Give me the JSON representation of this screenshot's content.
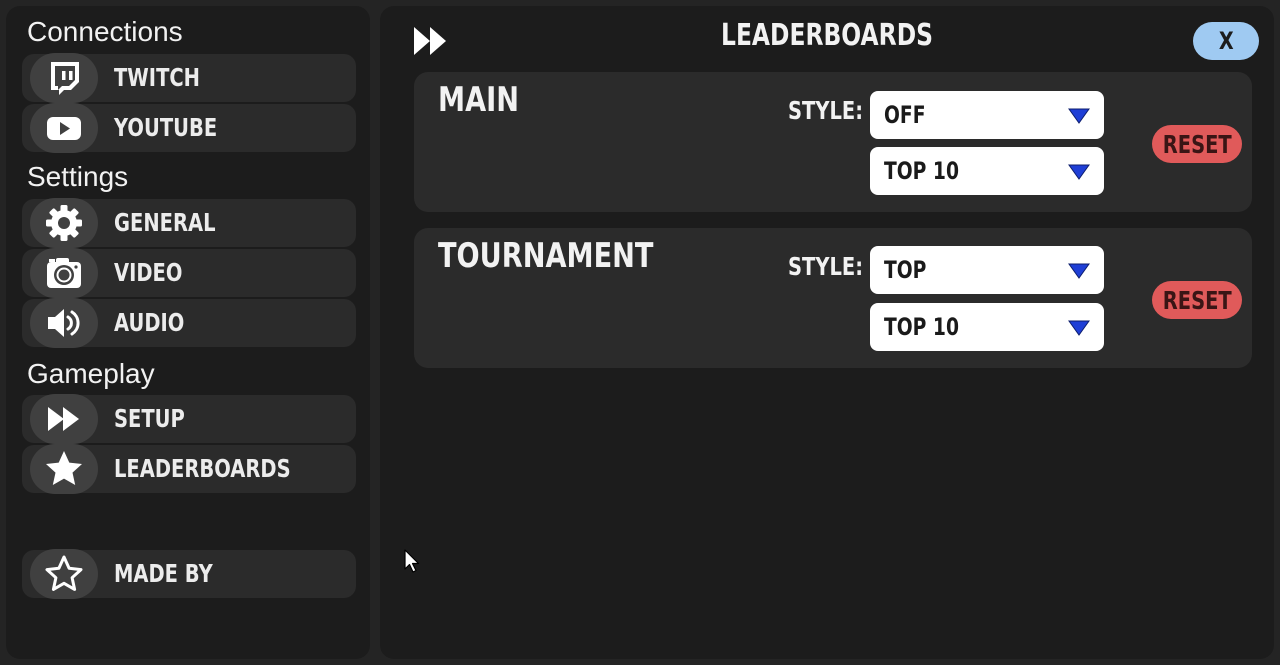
{
  "sidebar": {
    "sections": {
      "connections": "Connections",
      "settings": "Settings",
      "gameplay": "Gameplay"
    },
    "items": {
      "twitch": {
        "label": "TWITCH",
        "icon": "twitch-icon"
      },
      "youtube": {
        "label": "YOUTUBE",
        "icon": "youtube-icon"
      },
      "general": {
        "label": "GENERAL",
        "icon": "gear-icon"
      },
      "video": {
        "label": "VIDEO",
        "icon": "camera-icon"
      },
      "audio": {
        "label": "AUDIO",
        "icon": "speaker-icon"
      },
      "setup": {
        "label": "SETUP",
        "icon": "fast-forward-icon"
      },
      "leaderboards": {
        "label": "LEADERBOARDS",
        "icon": "star-icon"
      },
      "made_by": {
        "label": "MADE BY",
        "icon": "star-outline-icon"
      }
    }
  },
  "header": {
    "title": "LEADERBOARDS",
    "close_label": "X",
    "icon": "fast-forward-icon"
  },
  "cards": {
    "main": {
      "title": "MAIN",
      "style_label": "STYLE:",
      "style_value": "OFF",
      "count_value": "TOP 10",
      "reset_label": "RESET"
    },
    "tournament": {
      "title": "TOURNAMENT",
      "style_label": "STYLE:",
      "style_value": "TOP",
      "count_value": "TOP 10",
      "reset_label": "RESET"
    }
  },
  "colors": {
    "background": "#242424",
    "panel": "#1c1c1c",
    "card": "#2b2b2b",
    "close_button": "#9fcaf2",
    "reset_button": "#e05a5a",
    "dropdown_arrow": "#1f3fd6"
  }
}
